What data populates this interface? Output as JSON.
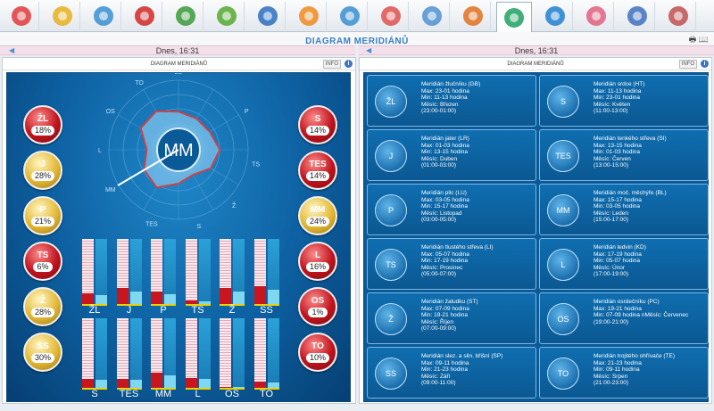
{
  "toolbar": {
    "icons": [
      "heart-icon",
      "sun-icon",
      "grid-icon",
      "bar-chart-icon",
      "molecule-icon",
      "leaf-icon",
      "globe-icon",
      "pie-chart-icon",
      "wave-icon",
      "color-bars-icon",
      "head-icon",
      "om-icon",
      "yin-yang-icon",
      "star-icon",
      "pentagon-icon",
      "statistics-icon",
      "badge-icon"
    ],
    "active_index": 12
  },
  "title": "DIAGRAM MERIDIÁNŮ",
  "date_left": "Dnes, 16:31",
  "date_right": "Dnes, 16:31",
  "left_panel": {
    "title": "DIAGRAM MERIDIÁNŮ",
    "info": "INFO"
  },
  "right_panel": {
    "title": "DIAGRAM MERIDIÁNŮ",
    "info": "INFO"
  },
  "center_label": "MM",
  "wheel_labels": [
    "ŽL",
    "P",
    "TS",
    "Ž",
    "S",
    "TES",
    "MM",
    "L",
    "OS",
    "TO"
  ],
  "badges_left": [
    {
      "label": "ŽL",
      "percent": "18%",
      "color": "red"
    },
    {
      "label": "J",
      "percent": "28%",
      "color": "gold"
    },
    {
      "label": "P",
      "percent": "21%",
      "color": "gold"
    },
    {
      "label": "TS",
      "percent": "6%",
      "color": "red"
    },
    {
      "label": "Ž",
      "percent": "28%",
      "color": "gold"
    },
    {
      "label": "SS",
      "percent": "30%",
      "color": "gold"
    }
  ],
  "badges_right": [
    {
      "label": "S",
      "percent": "14%",
      "color": "red"
    },
    {
      "label": "TES",
      "percent": "14%",
      "color": "red"
    },
    {
      "label": "MM",
      "percent": "24%",
      "color": "gold"
    },
    {
      "label": "L",
      "percent": "16%",
      "color": "red"
    },
    {
      "label": "OS",
      "percent": "1%",
      "color": "red"
    },
    {
      "label": "TO",
      "percent": "10%",
      "color": "red"
    }
  ],
  "bars_top": [
    {
      "label": "ŽL",
      "red": 0.18,
      "blue": 0.15
    },
    {
      "label": "J",
      "red": 0.28,
      "blue": 0.22
    },
    {
      "label": "P",
      "red": 0.21,
      "blue": 0.16
    },
    {
      "label": "TS",
      "red": 0.06,
      "blue": 0.05
    },
    {
      "label": "Ž",
      "red": 0.28,
      "blue": 0.22
    },
    {
      "label": "SS",
      "red": 0.3,
      "blue": 0.24
    }
  ],
  "bars_bottom": [
    {
      "label": "S",
      "red": 0.14,
      "blue": 0.13
    },
    {
      "label": "TES",
      "red": 0.14,
      "blue": 0.13
    },
    {
      "label": "MM",
      "red": 0.24,
      "blue": 0.2
    },
    {
      "label": "L",
      "red": 0.16,
      "blue": 0.14
    },
    {
      "label": "OS",
      "red": 0.01,
      "blue": 0.02
    },
    {
      "label": "TO",
      "red": 0.1,
      "blue": 0.09
    }
  ],
  "cards": [
    {
      "icon": "ŽL",
      "lines": [
        "Meridián žlučníku (GB)",
        "Max: 23-01 hodina",
        "Min: 11-13 hodina",
        "Měsíc: Březen",
        "(23:00-01:00)"
      ]
    },
    {
      "icon": "S",
      "lines": [
        "Meridián srdce (HT)",
        "Max: 11-13 hodina",
        "Min: 23-01 hodina",
        "Měsíc: Květen",
        "(11:00-13:00)"
      ]
    },
    {
      "icon": "J",
      "lines": [
        "Meridián jater (LR)",
        "Max: 01-03 hodina",
        "Min: 13-15 hodina",
        "Měsíc: Duben",
        "(01:00-03:00)"
      ]
    },
    {
      "icon": "TES",
      "lines": [
        "Meridián tenkého střeva (SI)",
        "Max: 13-15 hodina",
        "Min: 01-03 hodina",
        "Měsíc: Červen",
        "(13:00-15:00)"
      ]
    },
    {
      "icon": "P",
      "lines": [
        "Meridián plic (LU)",
        "Max: 03-05 hodina",
        "Min: 15-17 hodina",
        "Měsíc: Listopad",
        "(03:00-05:00)"
      ]
    },
    {
      "icon": "MM",
      "lines": [
        "Meridián moč. měchýře (BL)",
        "Max: 15-17 hodina",
        "Min: 03-05 hodina",
        "Měsíc: Leden",
        "(15:00-17:00)"
      ]
    },
    {
      "icon": "TS",
      "lines": [
        "Meridián tlustého střeva (LI)",
        "Max: 05-07 hodina",
        "Min: 17-19 hodina",
        "Měsíc: Prosinec",
        "(05:00-07:00)"
      ]
    },
    {
      "icon": "L",
      "lines": [
        "Meridián ledvin (KD)",
        "Max: 17-19 hodina",
        "Min: 05-07 hodina",
        "Měsíc: Únor",
        "(17:00-19:00)"
      ]
    },
    {
      "icon": "Ž",
      "lines": [
        "Meridián žaludku (ST)",
        "Max: 07-09 hodina",
        "Min: 19-21 hodina",
        "Měsíc: Říjen",
        "(07:00-09:00)"
      ]
    },
    {
      "icon": "OS",
      "lines": [
        "Meridián osrdečníku (PC)",
        "Max: 19-21 hodina",
        "Min: 07-09 hodina nMěsíc: Červenec",
        "(19:00-21:00)"
      ]
    },
    {
      "icon": "SS",
      "lines": [
        "Meridián slez. a slin. břišní (SP)",
        "Max: 09-11 hodina",
        "Min: 21-23 hodina",
        "Měsíc: Září",
        "(09:00-11:00)"
      ]
    },
    {
      "icon": "TO",
      "lines": [
        "Meridián trojitého ohřívače (TE)",
        "Max: 21-23 hodina",
        "Min: 09-11 hodina",
        "Měsíc: Srpen",
        "(21:00-23:00)"
      ]
    }
  ],
  "colors": {
    "accent": "#3a7fc1",
    "panel_bg": "#0d5fa0",
    "red": "#c9151e",
    "gold": "#e3b836"
  }
}
